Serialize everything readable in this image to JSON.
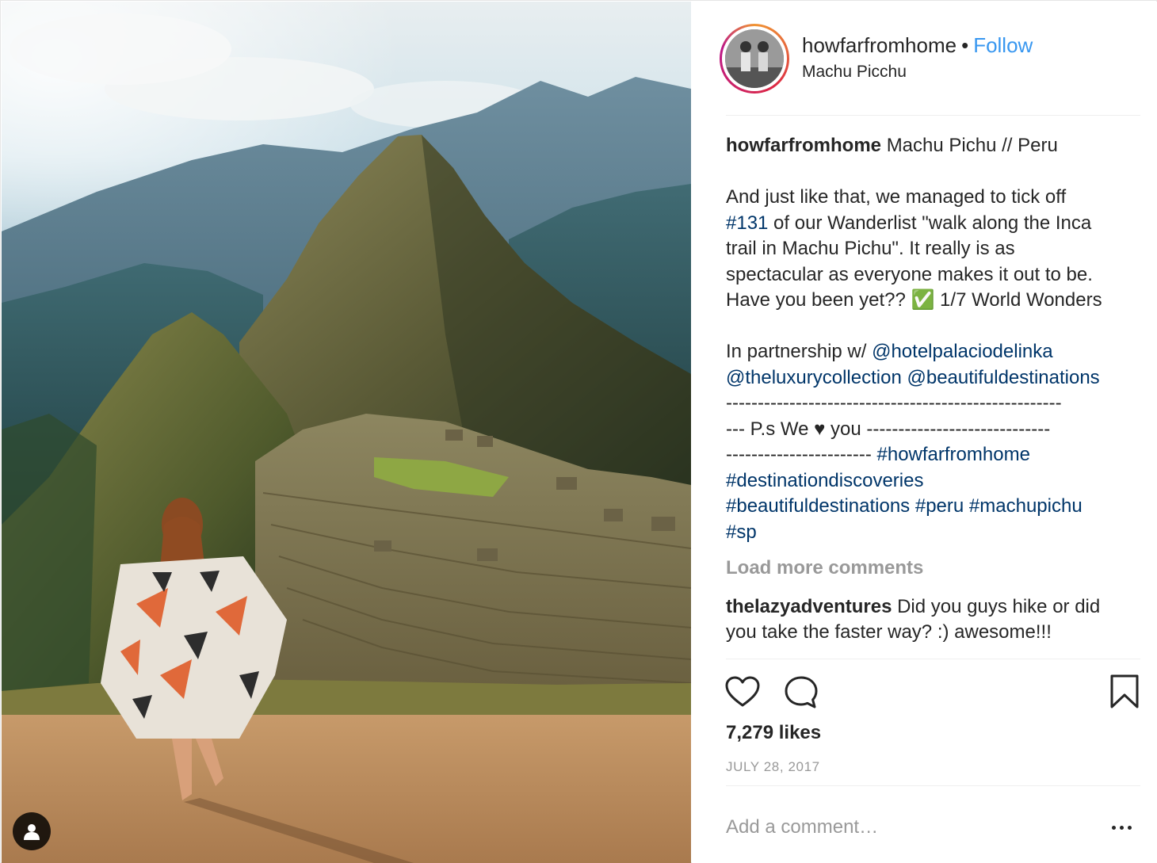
{
  "post": {
    "author": {
      "username": "howfarfromhome",
      "follow_label": "Follow",
      "separator": "•",
      "location": "Machu Picchu"
    },
    "caption": {
      "username": "howfarfromhome",
      "title": "Machu Pichu // Peru",
      "line1": "And just like that, we managed to tick off",
      "line2_tag": "#131",
      "line2_rest": " of our Wanderlist \"walk along the Inca",
      "line3": "trail in Machu Pichu\". It really is as",
      "line4": "spectacular as everyone makes it out to be.",
      "line5": "Have you been yet?? ✅ 1/7 World Wonders",
      "partnership_prefix": "In partnership w/ ",
      "mention1": "@hotelpalaciodelinka",
      "mention2": "@theluxurycollection",
      "mention3": "@beautifuldestinations",
      "dashes1": "-----------------------------------------------------",
      "ps_prefix": "--- P.s We ",
      "heart_glyph": "♥",
      "ps_suffix": " you -----------------------------",
      "dashes3": "----------------------- ",
      "tag_howfarfromhome": "#howfarfromhome",
      "tag_destinationdiscoveries": "#destinationdiscoveries",
      "tag_beautifuldestinations": "#beautifuldestinations",
      "tag_peru": "#peru",
      "tag_machupichu": "#machupichu",
      "tag_sp": "#sp"
    },
    "load_more_label": "Load more comments",
    "comments": [
      {
        "username": "thelazyadventures",
        "text_line1": "Did you guys hike or did",
        "text_line2": "you take the faster way? :) awesome!!!"
      }
    ],
    "likes_text": "7,279 likes",
    "date_text": "JULY 28, 2017",
    "add_comment_placeholder": "Add a comment…",
    "icons": {
      "like": "heart-outline-icon",
      "comment": "speech-bubble-icon",
      "save": "bookmark-icon",
      "more": "ellipsis-icon",
      "tagged": "person-icon"
    },
    "colors": {
      "follow": "#3897f0",
      "link": "#003569",
      "muted": "#999999",
      "text": "#262626"
    }
  }
}
